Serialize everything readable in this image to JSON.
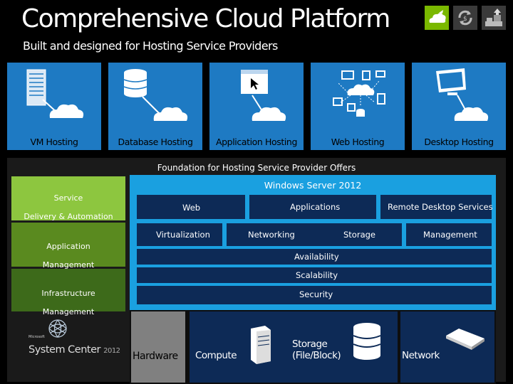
{
  "header": {
    "title": "Comprehensive Cloud Platform",
    "subtitle": "Built and designed for Hosting Service Providers"
  },
  "top_icons": [
    "cloud-icon",
    "sync-icon",
    "upload-chart-icon"
  ],
  "tiles": [
    {
      "label": "VM Hosting",
      "icon": "server-cloud-icon"
    },
    {
      "label": "Database Hosting",
      "icon": "database-cloud-icon"
    },
    {
      "label": "Application Hosting",
      "icon": "window-cloud-icon"
    },
    {
      "label": "Web Hosting",
      "icon": "web-network-icon"
    },
    {
      "label": "Desktop Hosting",
      "icon": "desktop-cloud-icon"
    }
  ],
  "foundation": {
    "label": "Foundation for Hosting Service Provider Offers"
  },
  "system_center": {
    "items": [
      {
        "label_line1": "Service",
        "label_line2": "Delivery & Automation"
      },
      {
        "label_line1": "Application",
        "label_line2": "Management"
      },
      {
        "label_line1": "Infrastructure",
        "label_line2": "Management"
      }
    ],
    "logo_small": "Microsoft",
    "logo_text": "System Center",
    "logo_year": "2012"
  },
  "windows_server": {
    "title": "Windows Server 2012",
    "row1": {
      "web": "Web",
      "applications": "Applications",
      "rds": "Remote Desktop Services"
    },
    "row2": {
      "virtualization": "Virtualization",
      "networking": "Networking",
      "storage": "Storage",
      "management": "Management"
    },
    "availability": "Availability",
    "scalability": "Scalability",
    "security": "Security"
  },
  "hardware": {
    "label": "Hardware",
    "compute": "Compute",
    "storage_line1": "Storage",
    "storage_line2": "(File/Block)",
    "network": "Network"
  },
  "colors": {
    "tile_blue": "#1e7ac3",
    "windows_server_blue": "#1aa0e0",
    "cell_navy": "#0d2a56",
    "green_light": "#8dc63f",
    "green_mid": "#5a8a1f",
    "green_dark": "#3d6a1a"
  }
}
